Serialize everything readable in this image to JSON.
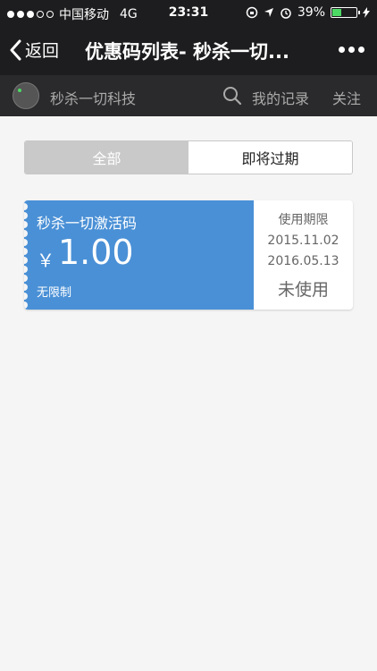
{
  "status_bar": {
    "carrier": "中国移动",
    "network": "4G",
    "time": "23:31",
    "battery": "39%",
    "battery_level": 0.39,
    "battery_color": "#4cd964"
  },
  "nav": {
    "back_label": "返回",
    "title": "优惠码列表- 秒杀一切...",
    "more_icon": "more-dots-icon"
  },
  "account_bar": {
    "name": "秒杀一切科技",
    "records_label": "我的记录",
    "follow_label": "关注"
  },
  "tabs": [
    {
      "label": "全部",
      "active": true
    },
    {
      "label": "即将过期",
      "active": false
    }
  ],
  "coupon": {
    "name": "秒杀一切激活码",
    "currency": "￥",
    "amount": "1.00",
    "limit": "无限制",
    "validity_label": "使用期限",
    "start_date": "2015.11.02",
    "end_date": "2016.05.13",
    "status": "未使用",
    "accent_color": "#4a90d6"
  }
}
